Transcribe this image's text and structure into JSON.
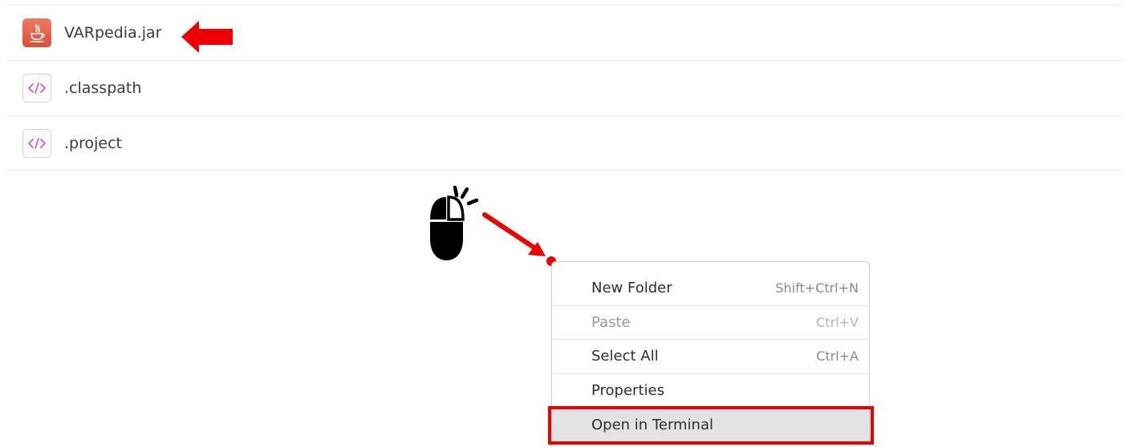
{
  "files": [
    {
      "name": "VARpedia.jar",
      "icon": "java-jar-icon"
    },
    {
      "name": ".classpath",
      "icon": "xml-code-icon"
    },
    {
      "name": ".project",
      "icon": "xml-code-icon"
    }
  ],
  "context_menu": {
    "items": [
      {
        "label": "New Folder",
        "shortcut": "Shift+Ctrl+N",
        "enabled": true
      },
      {
        "label": "Paste",
        "shortcut": "Ctrl+V",
        "enabled": false
      },
      {
        "label": "Select All",
        "shortcut": "Ctrl+A",
        "enabled": true
      },
      {
        "label": "Properties",
        "shortcut": "",
        "enabled": true
      },
      {
        "label": "Open in Terminal",
        "shortcut": "",
        "enabled": true,
        "highlighted": true
      }
    ]
  },
  "annotations": {
    "arrow_target": "VARpedia.jar",
    "mouse_icon": "right-click-mouse-icon",
    "highlighted_item": "Open in Terminal"
  },
  "colors": {
    "annotation_red": "#ee0000",
    "jar_icon": "#e0604a",
    "xml_icon_glyph": "#c25bd6",
    "highlight_bg": "#e3e3e3"
  }
}
